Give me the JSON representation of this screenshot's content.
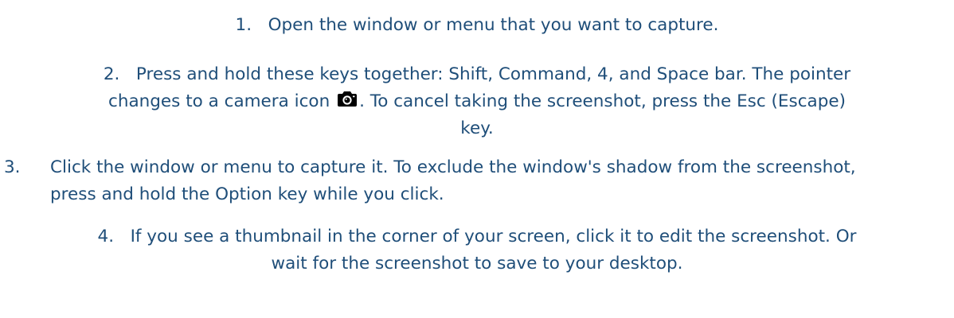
{
  "steps": [
    {
      "number": "1.",
      "text": "Open the window or menu that you want to capture."
    },
    {
      "number": "2.",
      "text_part1": "Press and hold these keys together: Shift, Command, 4, and Space bar. The pointer",
      "text_part2": "changes to a camera icon",
      "text_part3": ". To cancel taking the screenshot, press the Esc (Escape)",
      "text_part4": "key.",
      "icon": "camera-icon"
    },
    {
      "number": "3.",
      "text": "Click the window or menu to capture it. To exclude the window's shadow from the screenshot, press and hold the Option key while you click."
    },
    {
      "number": "4.",
      "text_part1": "If you see a thumbnail in the corner of your screen, click it to edit the screenshot. Or",
      "text_part2": "wait for the screenshot to save to your desktop."
    }
  ],
  "colors": {
    "text": "#1f4e79",
    "icon": "#000000"
  }
}
